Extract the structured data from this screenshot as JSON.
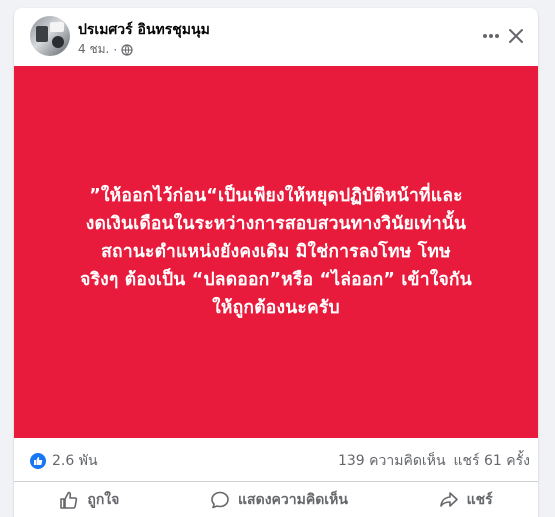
{
  "post": {
    "author": "ปรเมศวร์ อินทรชุมนุม",
    "time": "4 ชม.",
    "separator": "·",
    "text": "”ให้ออกไว้ก่อน“เป็นเพียงให้หยุดปฏิบัติหน้าที่และ\nงดเงินเดือนในระหว่างการสอบสวนทางวินัยเท่านั้น\nสถานะตำแหน่งยังคงเดิม มิใช่การลงโทษ โทษ\nจริงๆ ต้องเป็น “ปลดออก”หรือ “ไล่ออก” เข้าใจกัน\nให้ถูกต้องนะครับ",
    "image_bg_color": "#e81b3c"
  },
  "stats": {
    "reactions": "2.6 พัน",
    "comments": "139 ความคิดเห็น",
    "shares": "แชร์ 61 ครั้ง"
  },
  "actions": {
    "like": "ถูกใจ",
    "comment": "แสดงความคิดเห็น",
    "share": "แชร์"
  },
  "colors": {
    "accent": "#1877f2",
    "secondary_text": "#65676b"
  },
  "icons": [
    "more-horizontal-icon",
    "close-icon",
    "globe-icon",
    "like-badge-icon",
    "thumbs-up-icon",
    "comment-bubble-icon",
    "share-arrow-icon"
  ]
}
